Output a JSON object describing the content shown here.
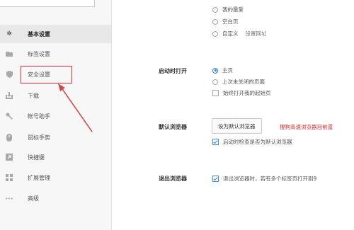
{
  "sidebar": {
    "items": [
      {
        "label": "基本设置",
        "icon": "gear-icon",
        "active": true
      },
      {
        "label": "标签设置",
        "icon": "tab-icon"
      },
      {
        "label": "安全设置",
        "icon": "shield-icon"
      },
      {
        "label": "下载",
        "icon": "download-icon"
      },
      {
        "label": "帐号助手",
        "icon": "key-icon"
      },
      {
        "label": "鼠标手势",
        "icon": "mouse-icon"
      },
      {
        "label": "快捷键",
        "icon": "shortcut-icon"
      },
      {
        "label": "扩展管理",
        "icon": "extensions-icon"
      },
      {
        "label": "高级",
        "icon": "more-icon"
      }
    ]
  },
  "homepage_options": {
    "favorites": "我的最爱",
    "blank": "空白页",
    "custom": "自定义",
    "set_url_link": "设置网址"
  },
  "startup": {
    "label": "启动时打开",
    "options": [
      "主页",
      "上次未关闭的页面"
    ],
    "selected_index": 0,
    "always_open_start": "始终打开我的起始页"
  },
  "default_browser": {
    "label": "默认浏览器",
    "button": "设为默认浏览器",
    "warning": "搜狗高速浏览器目前還",
    "check_on_start": "启动时检查是否为默认浏览器"
  },
  "exit_browser": {
    "label": "退出浏览器",
    "option": "退出浏览器时，若有多个标签页打开则9"
  }
}
